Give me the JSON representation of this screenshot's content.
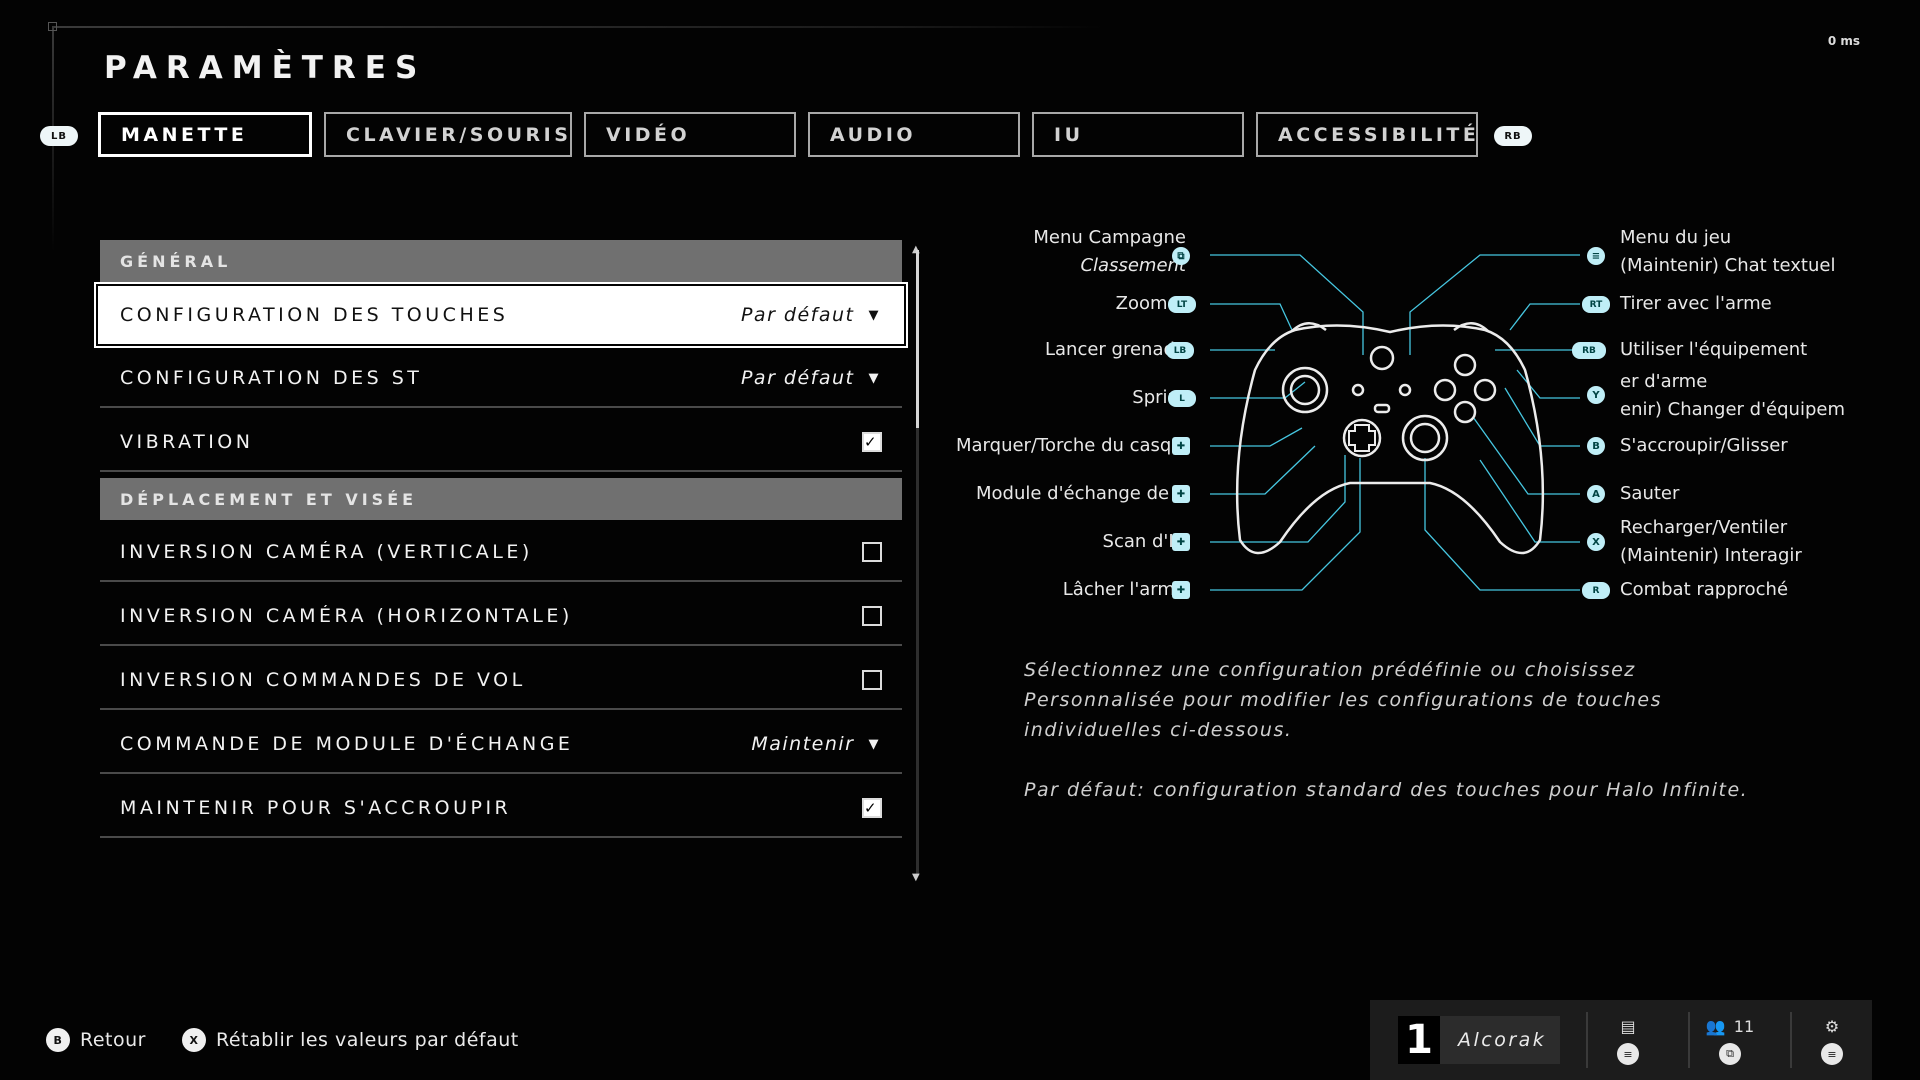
{
  "header": {
    "title": "PARAMÈTRES",
    "latency": "0 ms",
    "lb": "LB",
    "rb": "RB"
  },
  "tabs": [
    {
      "label": "MANETTE",
      "active": true
    },
    {
      "label": "CLAVIER/SOURIS"
    },
    {
      "label": "VIDÉO"
    },
    {
      "label": "AUDIO"
    },
    {
      "label": "IU"
    },
    {
      "label": "ACCESSIBILITÉ"
    }
  ],
  "sections": {
    "general": "GÉNÉRAL",
    "movement": "DÉPLACEMENT ET VISÉE"
  },
  "settings": {
    "button_layout": {
      "label": "CONFIGURATION DES TOUCHES",
      "value": "Par défaut"
    },
    "stick_layout": {
      "label": "CONFIGURATION DES STICKS ANALOGIQUES",
      "value": "Par défaut"
    },
    "vibration": {
      "label": "VIBRATION",
      "checked": true
    },
    "invert_vertical": {
      "label": "INVERSION CAMÉRA (VERTICALE)",
      "checked": false
    },
    "invert_horizontal": {
      "label": "INVERSION CAMÉRA (HORIZONTALE)",
      "checked": false
    },
    "invert_flight": {
      "label": "INVERSION COMMANDES DE VOL",
      "checked": false
    },
    "equipment_swap": {
      "label": "COMMANDE DE MODULE D'ÉCHANGE",
      "value": "Maintenir"
    },
    "hold_crouch": {
      "label": "MAINTENIR POUR S'ACCROUPIR",
      "checked": true
    }
  },
  "controller_map": {
    "left": [
      {
        "label": "Menu Campagne",
        "sub": "Classement",
        "glyph": "⧉"
      },
      {
        "label": "Zoomer",
        "glyph": "LT"
      },
      {
        "label": "Lancer grenade",
        "glyph": "LB"
      },
      {
        "label": "Sprint",
        "glyph": "L"
      },
      {
        "label": "Marquer/Torche du casque",
        "glyph": "✚"
      },
      {
        "label": "Module d'échange de grenade",
        "glyph": "✚"
      },
      {
        "label": "Scan d'IA",
        "glyph": "✚"
      },
      {
        "label": "Lâcher l'arme",
        "glyph": "✚"
      }
    ],
    "right": [
      {
        "label": "Menu du jeu",
        "sub": "(Maintenir) Chat textuel",
        "glyph": "≡"
      },
      {
        "label": "Tirer avec l'arme",
        "glyph": "RT"
      },
      {
        "label": "Utiliser l'équipement",
        "glyph": "RB"
      },
      {
        "label": "er d'arme",
        "sub": "enir) Changer d'équipement",
        "glyph": "Y"
      },
      {
        "label": "S'accroupir/Glisser",
        "glyph": "B"
      },
      {
        "label": "Sauter",
        "glyph": "A"
      },
      {
        "label": "Recharger/Ventiler",
        "sub": "(Maintenir) Interagir",
        "glyph": "X"
      },
      {
        "label": "Combat rapproché",
        "glyph": "R"
      }
    ],
    "accent": "#46c6e0"
  },
  "description": {
    "line1": "Sélectionnez une configuration prédéfinie ou choisissez Personnalisée pour modifier les configurations de touches individuelles ci-dessous.",
    "line2": "Par défaut: configuration standard des touches pour Halo Infinite."
  },
  "footer": {
    "back_glyph": "B",
    "back": "Retour",
    "reset_glyph": "X",
    "reset": "Rétablir les valeurs par défaut"
  },
  "profile": {
    "rank": "1",
    "gamertag": "Alcorak",
    "friends_count": "11"
  }
}
